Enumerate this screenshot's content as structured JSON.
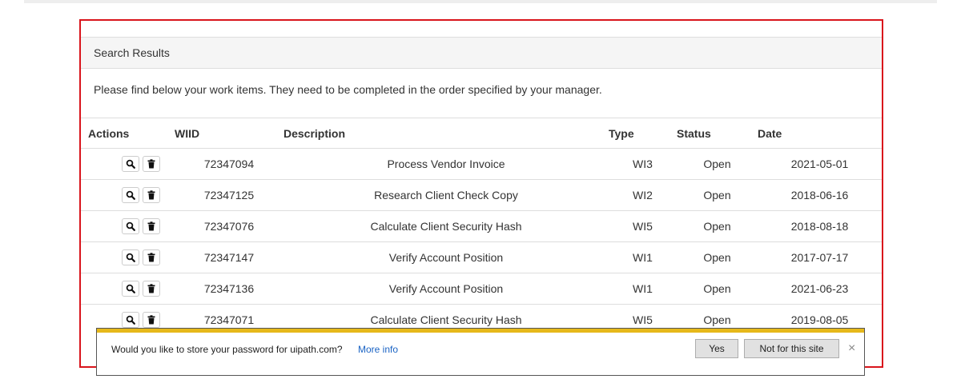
{
  "panel": {
    "heading": "Search Results",
    "intro": "Please find below your work items. They need to be completed in the order specified by your manager."
  },
  "table": {
    "headers": {
      "actions": "Actions",
      "wiid": "WIID",
      "description": "Description",
      "type": "Type",
      "status": "Status",
      "date": "Date"
    },
    "rows": [
      {
        "wiid": "72347094",
        "description": "Process Vendor Invoice",
        "type": "WI3",
        "status": "Open",
        "date": "2021-05-01"
      },
      {
        "wiid": "72347125",
        "description": "Research Client Check Copy",
        "type": "WI2",
        "status": "Open",
        "date": "2018-06-16"
      },
      {
        "wiid": "72347076",
        "description": "Calculate Client Security Hash",
        "type": "WI5",
        "status": "Open",
        "date": "2018-08-18"
      },
      {
        "wiid": "72347147",
        "description": "Verify Account Position",
        "type": "WI1",
        "status": "Open",
        "date": "2017-07-17"
      },
      {
        "wiid": "72347136",
        "description": "Verify Account Position",
        "type": "WI1",
        "status": "Open",
        "date": "2021-06-23"
      },
      {
        "wiid": "72347071",
        "description": "Calculate Client Security Hash",
        "type": "WI5",
        "status": "Open",
        "date": "2019-08-05"
      }
    ]
  },
  "icons": {
    "view": "search-icon",
    "delete": "trash-icon"
  },
  "password_bar": {
    "question": "Would you like to store your password for uipath.com?",
    "more_info": "More info",
    "yes_label": "Yes",
    "no_label": "Not for this site",
    "close_glyph": "×",
    "accent_color": "#e6b81a"
  },
  "colors": {
    "panel_border": "#d9141c",
    "link": "#1a63c4"
  }
}
